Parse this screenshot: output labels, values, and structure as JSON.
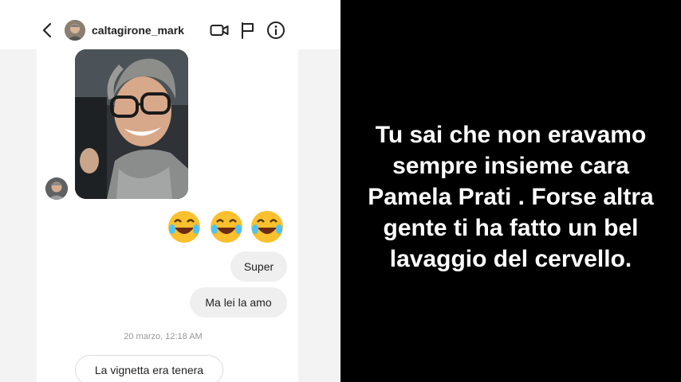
{
  "header": {
    "username": "caltagirone_mark",
    "back_icon": "chevron-left-icon",
    "video_icon": "video-camera-icon",
    "flag_icon": "flag-icon",
    "info_icon": "info-icon"
  },
  "messages": {
    "emojis": [
      "😂",
      "😂",
      "😂"
    ],
    "super": "Super",
    "lei": "Ma lei la amo",
    "timestamp": "20 marzo, 12:18 AM",
    "vignetta": "La vignetta era tenera"
  },
  "story": {
    "lines": [
      "Tu sai che non eravamo",
      "sempre insieme cara",
      "Pamela Prati . Forse altra",
      "gente ti ha fatto un bel",
      "lavaggio del cervello."
    ]
  },
  "colors": {
    "bubble_bg": "#efefef",
    "story_bg": "#000000",
    "story_text": "#ffffff"
  }
}
